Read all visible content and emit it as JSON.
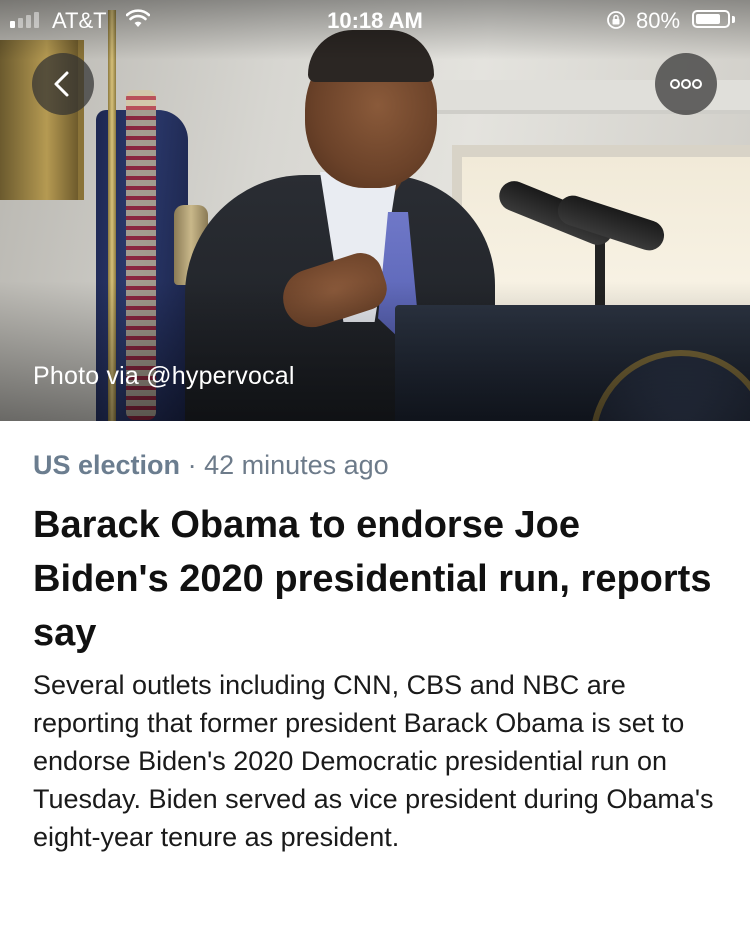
{
  "status_bar": {
    "carrier": "AT&T",
    "time": "10:18 AM",
    "battery_percent": "80%",
    "battery_level": 0.8,
    "signal_bars_filled": 1,
    "signal_bars_total": 4
  },
  "hero": {
    "caption": "Photo via @hypervocal"
  },
  "article": {
    "topic": "US election",
    "separator": "·",
    "timestamp": "42 minutes ago",
    "headline": "Barack Obama to endorse Joe Biden's 2020 presidential run, reports say",
    "summary": "Several outlets including CNN, CBS and NBC are reporting that former president Barack Obama is set to endorse Biden's 2020 Democratic presidential run on Tuesday. Biden served as vice president during Obama's eight-year tenure as president."
  },
  "icons": {
    "back": "chevron-left-icon",
    "more": "ellipsis-icon",
    "wifi": "wifi-icon",
    "lock": "rotation-lock-icon",
    "battery": "battery-icon"
  },
  "colors": {
    "meta_text": "#6d7b8a",
    "headline_text": "#111111",
    "button_bg": "#323232"
  }
}
